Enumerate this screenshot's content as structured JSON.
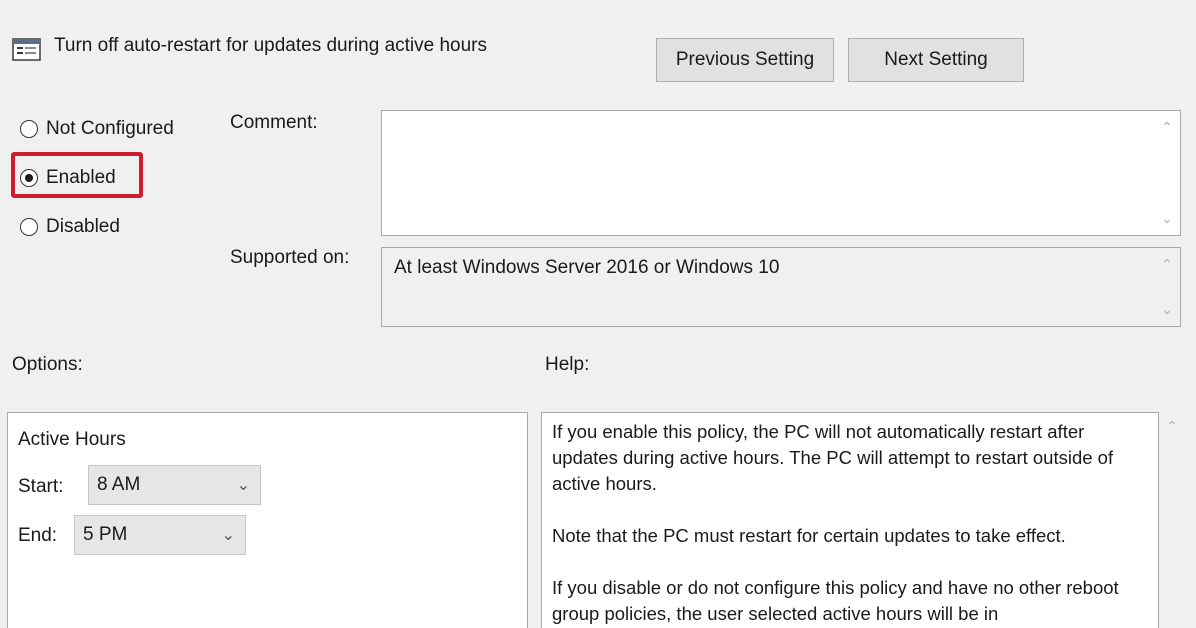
{
  "policy": {
    "title": "Turn off auto-restart for updates during active hours",
    "icon": "policy-setting-icon"
  },
  "buttons": {
    "previous": "Previous Setting",
    "next": "Next Setting"
  },
  "state": {
    "options": [
      "Not Configured",
      "Enabled",
      "Disabled"
    ],
    "selected": "Enabled",
    "highlight_color": "#cc1f2b"
  },
  "comment": {
    "label": "Comment:",
    "value": ""
  },
  "supported": {
    "label": "Supported on:",
    "value": "At least Windows Server 2016 or Windows 10"
  },
  "options_panel": {
    "label": "Options:",
    "group_title": "Active Hours",
    "start_label": "Start:",
    "start_value": "8 AM",
    "end_label": "End:",
    "end_value": "5 PM"
  },
  "help_panel": {
    "label": "Help:",
    "paragraphs": [
      "If you enable this policy, the PC will not automatically restart after updates during active hours. The PC will attempt to restart outside of active hours.",
      "Note that the PC must restart for certain updates to take effect.",
      "If you disable or do not configure this policy and have no other reboot group policies, the user selected active hours will be in"
    ]
  }
}
